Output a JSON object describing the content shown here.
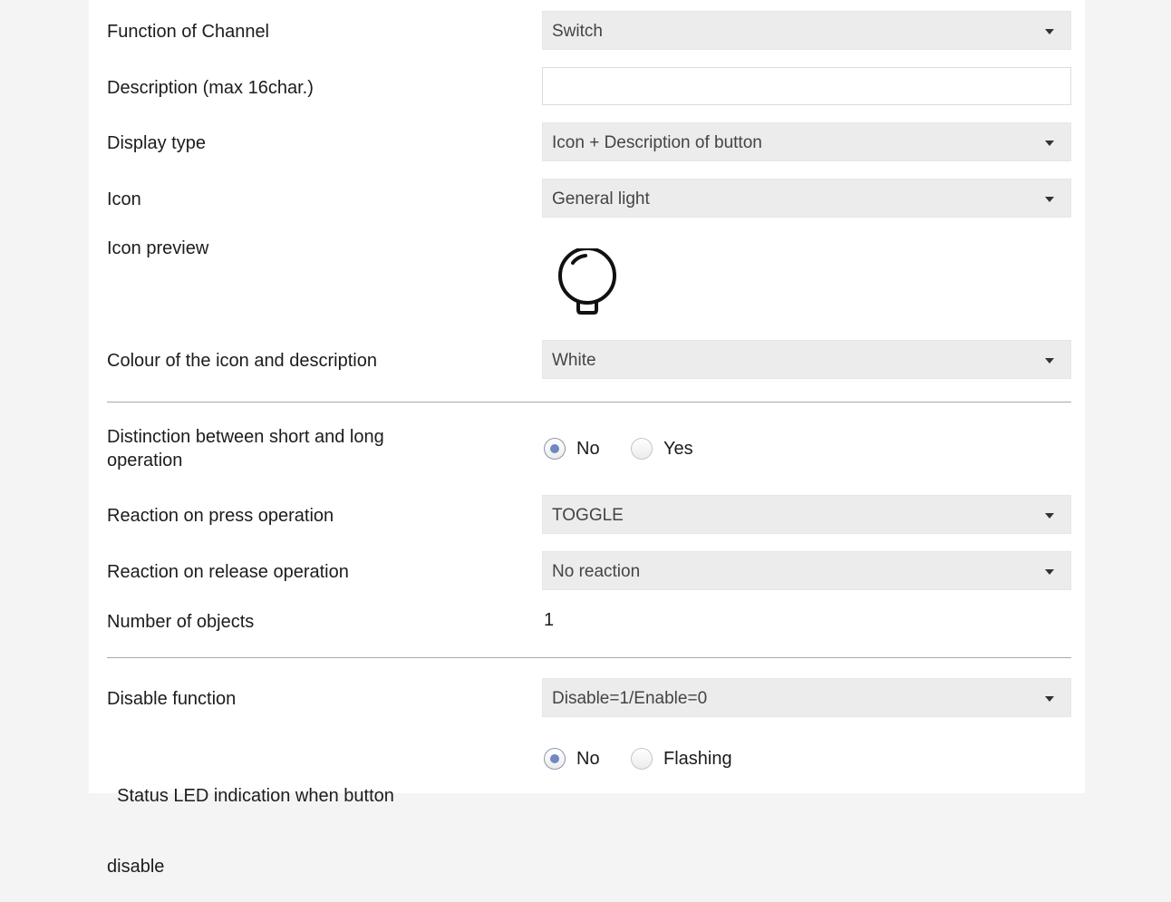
{
  "fields": {
    "function_of_channel": {
      "label": "Function of Channel",
      "value": "Switch"
    },
    "description": {
      "label": "Description (max 16char.)",
      "value": "",
      "placeholder": ""
    },
    "display_type": {
      "label": "Display type",
      "value": "Icon + Description of button"
    },
    "icon": {
      "label": "Icon",
      "value": "General light"
    },
    "icon_preview": {
      "label": "Icon preview",
      "icon": "light-bulb-icon"
    },
    "colour": {
      "label": "Colour of the icon and description",
      "value": "White"
    },
    "distinction": {
      "label_line1": "Distinction between short and long",
      "label_line2": "operation",
      "options": [
        "No",
        "Yes"
      ],
      "selected": "No"
    },
    "reaction_press": {
      "label": "Reaction on press operation",
      "value": "TOGGLE"
    },
    "reaction_release": {
      "label": "Reaction on release operation",
      "value": "No reaction"
    },
    "number_of_objects": {
      "label": "Number of objects",
      "value": "1"
    },
    "disable_function": {
      "label": "Disable function",
      "value": "Disable=1/Enable=0"
    },
    "status_led": {
      "label_line1": "  Status LED indication when button",
      "label_line2": "disable",
      "options": [
        "No",
        "Flashing"
      ],
      "selected": "No"
    }
  },
  "colors": {
    "panel": "#ffffff",
    "background": "#f4f4f4",
    "dropdown": "#ececec",
    "radio_checked": "#6f88c1"
  }
}
